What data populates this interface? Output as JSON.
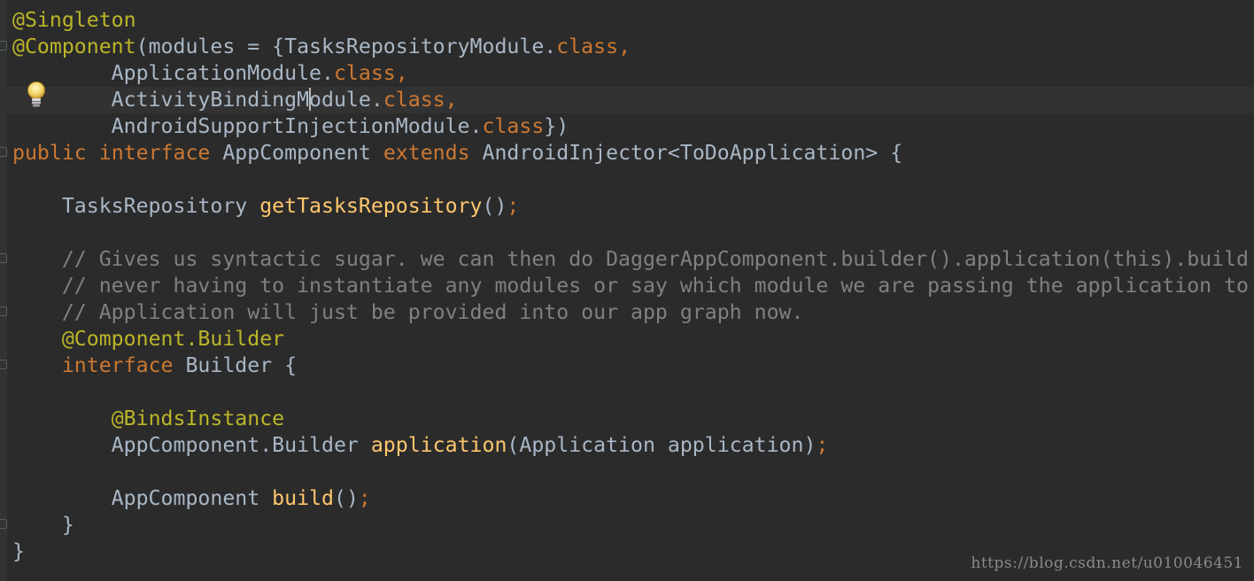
{
  "editor": {
    "lines": [
      {
        "tokens": [
          {
            "t": "@Singleton",
            "c": "ann"
          }
        ]
      },
      {
        "tokens": [
          {
            "t": "@Component",
            "c": "ann"
          },
          {
            "t": "(modules = {TasksRepositoryModule.",
            "c": "plain"
          },
          {
            "t": "class",
            "c": "kw"
          },
          {
            "t": ",",
            "c": "punct"
          }
        ]
      },
      {
        "tokens": [
          {
            "t": "        ApplicationModule.",
            "c": "plain"
          },
          {
            "t": "class",
            "c": "kw"
          },
          {
            "t": ",",
            "c": "punct"
          }
        ]
      },
      {
        "tokens": [
          {
            "t": "        ActivityBindingM",
            "c": "plain"
          },
          {
            "t": "",
            "c": "caret"
          },
          {
            "t": "odule.",
            "c": "plain"
          },
          {
            "t": "class",
            "c": "kw"
          },
          {
            "t": ",",
            "c": "punct"
          }
        ]
      },
      {
        "tokens": [
          {
            "t": "        AndroidSupportInjectionModule.",
            "c": "plain"
          },
          {
            "t": "class",
            "c": "kw"
          },
          {
            "t": "})",
            "c": "plain"
          }
        ]
      },
      {
        "tokens": [
          {
            "t": "public ",
            "c": "kw"
          },
          {
            "t": "interface ",
            "c": "kw"
          },
          {
            "t": "AppComponent ",
            "c": "plain"
          },
          {
            "t": "extends ",
            "c": "kw"
          },
          {
            "t": "AndroidInjector<ToDoApplication> {",
            "c": "plain"
          }
        ]
      },
      {
        "tokens": [
          {
            "t": "",
            "c": "plain"
          }
        ]
      },
      {
        "tokens": [
          {
            "t": "    TasksRepository ",
            "c": "plain"
          },
          {
            "t": "getTasksRepository",
            "c": "fn"
          },
          {
            "t": "()",
            "c": "plain"
          },
          {
            "t": ";",
            "c": "punct"
          }
        ]
      },
      {
        "tokens": [
          {
            "t": "",
            "c": "plain"
          }
        ]
      },
      {
        "tokens": [
          {
            "t": "    // Gives us syntactic sugar. we can then do DaggerAppComponent.builder().application(this).build",
            "c": "cmt"
          }
        ]
      },
      {
        "tokens": [
          {
            "t": "    // never having to instantiate any modules or say which module we are passing the application to",
            "c": "cmt"
          }
        ]
      },
      {
        "tokens": [
          {
            "t": "    // Application will just be provided into our app graph now.",
            "c": "cmt"
          }
        ]
      },
      {
        "tokens": [
          {
            "t": "    ",
            "c": "plain"
          },
          {
            "t": "@Component.Builder",
            "c": "ann"
          }
        ]
      },
      {
        "tokens": [
          {
            "t": "    ",
            "c": "plain"
          },
          {
            "t": "interface ",
            "c": "kw"
          },
          {
            "t": "Builder {",
            "c": "plain"
          }
        ]
      },
      {
        "tokens": [
          {
            "t": "",
            "c": "plain"
          }
        ]
      },
      {
        "tokens": [
          {
            "t": "        ",
            "c": "plain"
          },
          {
            "t": "@BindsInstance",
            "c": "ann"
          }
        ]
      },
      {
        "tokens": [
          {
            "t": "        AppComponent.Builder ",
            "c": "plain"
          },
          {
            "t": "application",
            "c": "fn"
          },
          {
            "t": "(Application application)",
            "c": "plain"
          },
          {
            "t": ";",
            "c": "punct"
          }
        ]
      },
      {
        "tokens": [
          {
            "t": "",
            "c": "plain"
          }
        ]
      },
      {
        "tokens": [
          {
            "t": "        AppComponent ",
            "c": "plain"
          },
          {
            "t": "build",
            "c": "fn"
          },
          {
            "t": "()",
            "c": "plain"
          },
          {
            "t": ";",
            "c": "punct"
          }
        ]
      },
      {
        "tokens": [
          {
            "t": "    }",
            "c": "plain"
          }
        ]
      },
      {
        "tokens": [
          {
            "t": "}",
            "c": "plain"
          }
        ]
      }
    ]
  },
  "intention_icon": "lightbulb-icon",
  "watermark": "https://blog.csdn.net/u010046451",
  "colors": {
    "background": "#2b2b2b",
    "annotation": "#bbb529",
    "keyword": "#cc7832",
    "method": "#ffc66d",
    "comment": "#808080",
    "text": "#a9b7c6"
  }
}
